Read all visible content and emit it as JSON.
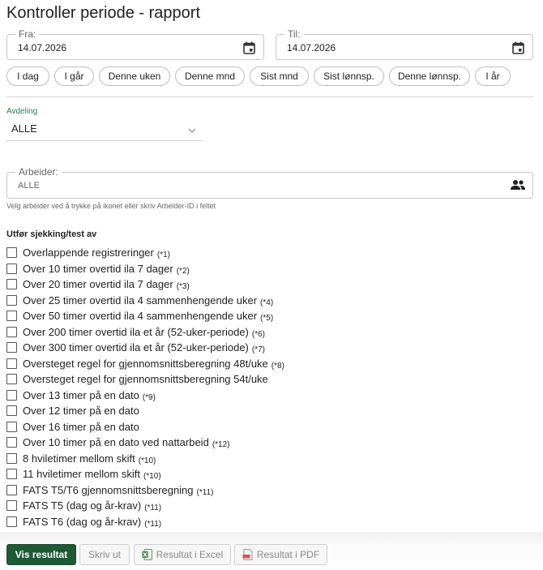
{
  "page": {
    "title": "Kontroller periode - rapport"
  },
  "dates": {
    "from": {
      "label": "Fra:",
      "value": "14.07.2026"
    },
    "to": {
      "label": "Til:",
      "value": "14.07.2026"
    }
  },
  "chips": [
    "I dag",
    "I går",
    "Denne uken",
    "Denne mnd",
    "Sist mnd",
    "Sist lønnsp.",
    "Denne lønnsp.",
    "I år"
  ],
  "department": {
    "label": "Avdeling",
    "value": "ALLE"
  },
  "worker": {
    "label": "Arbeider:",
    "placeholder": "ALLE",
    "hint": "Velg arbeider ved å trykke på ikonet eller skriv Arbeider-ID i feltet"
  },
  "checks_title": "Utfør sjekking/test av",
  "checks": [
    {
      "label": "Overlappende registreringer",
      "note": "(*1)"
    },
    {
      "label": "Over 10 timer overtid ila 7 dager",
      "note": "(*2)"
    },
    {
      "label": "Over 20 timer overtid ila 7 dager",
      "note": "(*3)"
    },
    {
      "label": "Over 25 timer overtid ila 4 sammenhengende uker",
      "note": "(*4)"
    },
    {
      "label": "Over 50 timer overtid ila 4 sammenhengende uker",
      "note": "(*5)"
    },
    {
      "label": "Over 200 timer overtid ila et år (52-uker-periode)",
      "note": "(*6)"
    },
    {
      "label": "Over 300 timer overtid ila et år (52-uker-periode)",
      "note": "(*7)"
    },
    {
      "label": "Oversteget regel for gjennomsnittsberegning 48t/uke",
      "note": "(*8)"
    },
    {
      "label": "Oversteget regel for gjennomsnittsberegning 54t/uke",
      "note": ""
    },
    {
      "label": "Over 13 timer på en dato",
      "note": "(*9)"
    },
    {
      "label": "Over 12 timer på en dato",
      "note": ""
    },
    {
      "label": "Over 16 timer på en dato",
      "note": ""
    },
    {
      "label": "Over 10 timer på en dato ved nattarbeid",
      "note": "(*12)"
    },
    {
      "label": "8 hviletimer mellom skift",
      "note": "(*10)"
    },
    {
      "label": "11 hviletimer mellom skift",
      "note": "(*10)"
    },
    {
      "label": "FATS T5/T6 gjennomsnittsberegning",
      "note": "(*11)"
    },
    {
      "label": "FATS T5 (dag og år-krav)",
      "note": "(*11)"
    },
    {
      "label": "FATS T6 (dag og år-krav)",
      "note": "(*11)"
    }
  ],
  "buttons": {
    "show": "Vis resultat",
    "print": "Skriv ut",
    "excel": "Resultat i Excel",
    "pdf": "Resultat i PDF"
  },
  "colors": {
    "primary": "#1f5a37",
    "label_green": "#2e7d4f"
  }
}
